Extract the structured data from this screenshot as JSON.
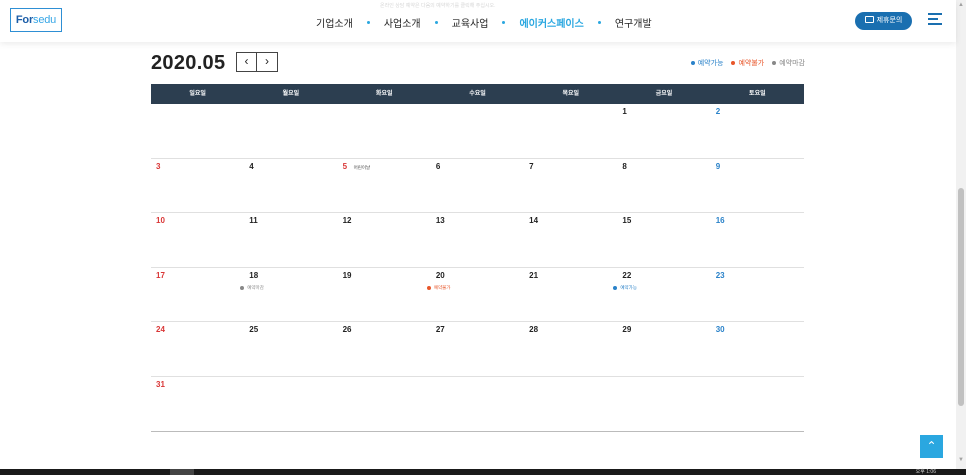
{
  "header": {
    "logo_part1": "For",
    "logo_part2": "sedu",
    "top_note": "온라인 상담 예약은 다음의 예약하기를 클릭해 주십시오.",
    "nav": [
      {
        "label": "기업소개",
        "active": false
      },
      {
        "label": "사업소개",
        "active": false
      },
      {
        "label": "교육사업",
        "active": false
      },
      {
        "label": "에이커스페이스",
        "active": true
      },
      {
        "label": "연구개발",
        "active": false
      }
    ],
    "inquiry_label": "제휴문의",
    "inquiry_icon": "chat-icon",
    "menu_icon": "hamburger-menu-icon"
  },
  "calendar": {
    "title": "2020.05",
    "prev_label": "‹",
    "next_label": "›",
    "legend": [
      {
        "label": "예약가능",
        "color": "#2a82c9"
      },
      {
        "label": "예약불가",
        "color": "#e8562a"
      },
      {
        "label": "예약마감",
        "color": "#888888"
      }
    ],
    "weekdays": [
      "일요일",
      "월요일",
      "화요일",
      "수요일",
      "목요일",
      "금요일",
      "토요일"
    ],
    "weeks": [
      [
        null,
        null,
        null,
        null,
        null,
        {
          "n": "1"
        },
        {
          "n": "2"
        }
      ],
      [
        {
          "n": "3"
        },
        {
          "n": "4"
        },
        {
          "n": "5",
          "holiday": true,
          "label": "어린이날"
        },
        {
          "n": "6"
        },
        {
          "n": "7"
        },
        {
          "n": "8"
        },
        {
          "n": "9"
        }
      ],
      [
        {
          "n": "10"
        },
        {
          "n": "11"
        },
        {
          "n": "12"
        },
        {
          "n": "13"
        },
        {
          "n": "14"
        },
        {
          "n": "15"
        },
        {
          "n": "16"
        }
      ],
      [
        {
          "n": "17"
        },
        {
          "n": "18",
          "status": "예약마감",
          "status_color": "#888888"
        },
        {
          "n": "19"
        },
        {
          "n": "20",
          "status": "예약불가",
          "status_color": "#e8562a"
        },
        {
          "n": "21"
        },
        {
          "n": "22",
          "status": "예약가능",
          "status_color": "#2a82c9"
        },
        {
          "n": "23"
        }
      ],
      [
        {
          "n": "24"
        },
        {
          "n": "25"
        },
        {
          "n": "26"
        },
        {
          "n": "27"
        },
        {
          "n": "28"
        },
        {
          "n": "29"
        },
        {
          "n": "30"
        }
      ],
      [
        {
          "n": "31"
        },
        null,
        null,
        null,
        null,
        null,
        null
      ]
    ]
  },
  "to_top_label": "⌃",
  "to_top_icon": "arrow-up-icon",
  "scrollbar": {
    "up_arrow": "▲",
    "down_arrow": "▼"
  },
  "taskbar": {
    "tray_text": "오후 1:06"
  }
}
